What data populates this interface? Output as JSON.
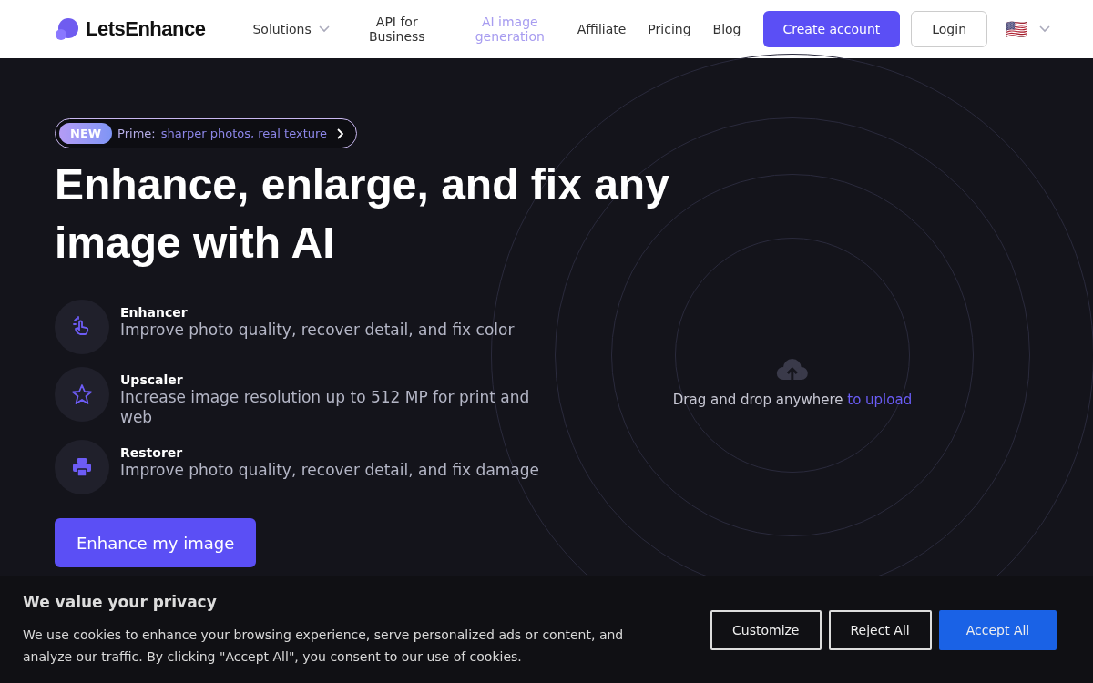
{
  "header": {
    "logo": "LetsEnhance",
    "nav": [
      {
        "label": "Solutions",
        "dropdown": true,
        "selected": false
      },
      {
        "label": "API for Business",
        "dropdown": false,
        "selected": false
      },
      {
        "label": "AI image generation",
        "dropdown": false,
        "selected": true
      },
      {
        "label": "Affiliate",
        "dropdown": false,
        "selected": false
      },
      {
        "label": "Pricing",
        "dropdown": false,
        "selected": false
      },
      {
        "label": "Blog",
        "dropdown": false,
        "selected": false
      }
    ],
    "create_account": "Create account",
    "login": "Login",
    "language_flag": "🇺🇸"
  },
  "hero": {
    "badge": {
      "tag": "NEW",
      "prefix": "Prime:",
      "text": "sharper photos, real texture"
    },
    "title": "Enhance, enlarge, and fix any image with AI",
    "features": [
      {
        "kind": "hand",
        "title": "Enhancer",
        "description": "Improve photo quality, recover detail, and fix color"
      },
      {
        "kind": "star",
        "title": "Upscaler",
        "description": "Increase image resolution up to 512 MP for print and web"
      },
      {
        "kind": "printer",
        "title": "Restorer",
        "description": "Improve photo quality, recover detail, and fix damage"
      }
    ],
    "cta": "Enhance my image"
  },
  "upload": {
    "text": "Drag and drop anywhere",
    "link": "to upload"
  },
  "cookie_banner": {
    "title": "We value your privacy",
    "text": "We use cookies to enhance your browsing experience, serve personalized ads or content, and analyze our traffic. By clicking \"Accept All\", you consent to our use of cookies.",
    "buttons": [
      "Customize",
      "Reject All",
      "Accept All"
    ]
  }
}
